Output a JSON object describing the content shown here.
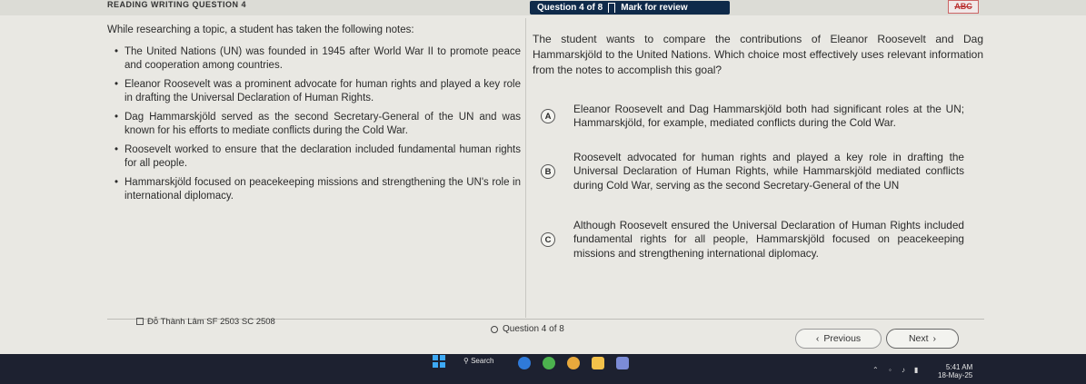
{
  "header": {
    "section_title": "READING WRITING QUESTION 4",
    "question_progress": "Question 4 of 8",
    "mark_for_review": "Mark for review",
    "abc_tool": "ABC"
  },
  "passage": {
    "intro": "While researching a topic, a student has taken the following notes:",
    "notes": [
      "The United Nations (UN) was founded in 1945 after World War II to promote peace and cooperation among countries.",
      "Eleanor Roosevelt was a prominent advocate for human rights and played a key role in drafting the Universal Declaration of Human Rights.",
      "Dag Hammarskjöld served as the second Secretary-General of the UN and was known for his efforts to mediate conflicts during the Cold War.",
      "Roosevelt worked to ensure that the declaration included fundamental human rights for all people.",
      "Hammarskjöld focused on peacekeeping missions and strengthening the UN's role in international diplomacy."
    ]
  },
  "question": {
    "prompt": "The student wants to compare the contributions of Eleanor Roosevelt and Dag Hammarskjöld to the United Nations. Which choice most effectively uses relevant information from the notes to accomplish this goal?",
    "choices": [
      {
        "letter": "A",
        "text": "Eleanor Roosevelt and Dag Hammarskjöld both had significant roles at the UN; Hammarskjöld, for example, mediated conflicts during the Cold War."
      },
      {
        "letter": "B",
        "text": "Roosevelt advocated for human rights and played a key role in drafting the Universal Declaration of Human Rights, while Hammarskjöld mediated conflicts during Cold War, serving as the second Secretary-General of the UN"
      },
      {
        "letter": "C",
        "text": "Although Roosevelt ensured the Universal Declaration of Human Rights included fundamental rights for all people, Hammarskjöld focused on peacekeeping missions and strengthening international diplomacy."
      }
    ]
  },
  "footer": {
    "student_name": "Đỗ Thành Lâm SF 2503 SC 2508",
    "question_progress": "Question 4 of 8",
    "previous_label": "Previous",
    "next_label": "Next"
  },
  "taskbar": {
    "search_label": "Search",
    "time": "5:41 AM",
    "date": "18-May-25"
  },
  "colors": {
    "header_bg": "#0f2a4a",
    "page_bg": "#e9e8e3",
    "taskbar_bg": "#1d2130"
  }
}
